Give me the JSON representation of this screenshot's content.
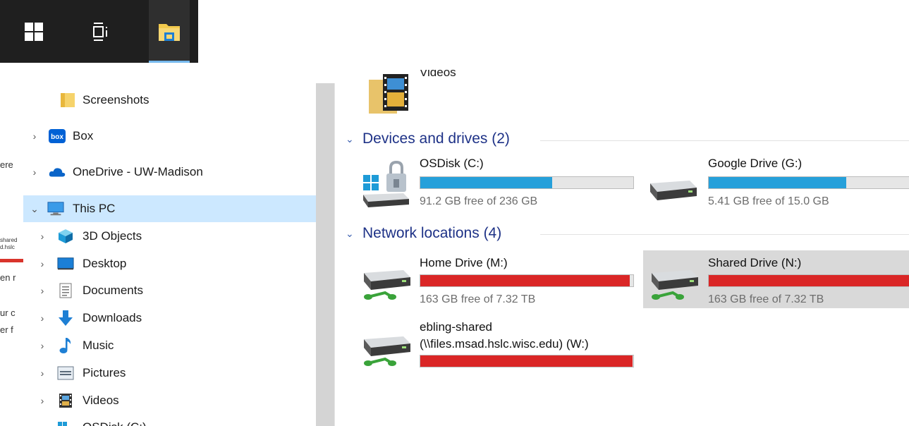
{
  "colors": {
    "selection": "#cce8ff",
    "bar_normal": "#26a0da",
    "bar_full": "#da2626",
    "group_heading": "#1e3287"
  },
  "taskbar": {
    "start_icon": "windows-logo-icon",
    "taskview_icon": "task-view-icon",
    "explorer_icon": "file-explorer-icon"
  },
  "background_fragments": [
    "ere",
    "shared",
    "d.hslc",
    "en r",
    "ur c",
    "er f"
  ],
  "nav": {
    "items": [
      {
        "label": "Screenshots",
        "icon": "folder-icon",
        "expandable": false
      },
      {
        "label": "Box",
        "icon": "box-icon",
        "expandable": true
      },
      {
        "label": "OneDrive - UW-Madison",
        "icon": "onedrive-cloud-icon",
        "expandable": true
      },
      {
        "label": "This PC",
        "icon": "computer-icon",
        "expandable": true,
        "expanded": true,
        "selected": true
      },
      {
        "label": "3D Objects",
        "icon": "3d-objects-icon",
        "expandable": true
      },
      {
        "label": "Desktop",
        "icon": "desktop-icon",
        "expandable": true
      },
      {
        "label": "Documents",
        "icon": "documents-icon",
        "expandable": true
      },
      {
        "label": "Downloads",
        "icon": "downloads-icon",
        "expandable": true
      },
      {
        "label": "Music",
        "icon": "music-icon",
        "expandable": true
      },
      {
        "label": "Pictures",
        "icon": "pictures-icon",
        "expandable": true
      },
      {
        "label": "Videos",
        "icon": "videos-icon",
        "expandable": true
      },
      {
        "label": "OSDisk (C:)",
        "icon": "drive-icon",
        "expandable": true
      }
    ],
    "box_logo_text": "box"
  },
  "content": {
    "partial_folder": {
      "label": "Videos",
      "icon": "videos-folder-icon"
    },
    "groups": [
      {
        "title": "Devices and drives (2)",
        "drives": [
          {
            "name": "OSDisk (C:)",
            "free_text": "91.2 GB free of 236 GB",
            "used_fraction": 0.614,
            "full": false,
            "icon": "windows-drive-icon"
          },
          {
            "name": "Google Drive (G:)",
            "free_text": "5.41 GB free of 15.0 GB",
            "used_fraction": 0.64,
            "full": false,
            "icon": "hard-drive-icon"
          }
        ]
      },
      {
        "title": "Network locations (4)",
        "drives": [
          {
            "name": "Home Drive (M:)",
            "free_text": "163 GB free of 7.32 TB",
            "used_fraction": 0.978,
            "full": true,
            "icon": "network-drive-icon"
          },
          {
            "name": "Shared Drive (N:)",
            "free_text": "163 GB free of 7.32 TB",
            "used_fraction": 0.978,
            "full": true,
            "icon": "network-drive-icon",
            "highlighted": true
          },
          {
            "name": "ebling-shared",
            "name_line2": "(\\\\files.msad.hslc.wisc.edu) (W:)",
            "free_text": "",
            "used_fraction": 0.99,
            "full": true,
            "icon": "network-drive-icon"
          }
        ]
      }
    ]
  }
}
